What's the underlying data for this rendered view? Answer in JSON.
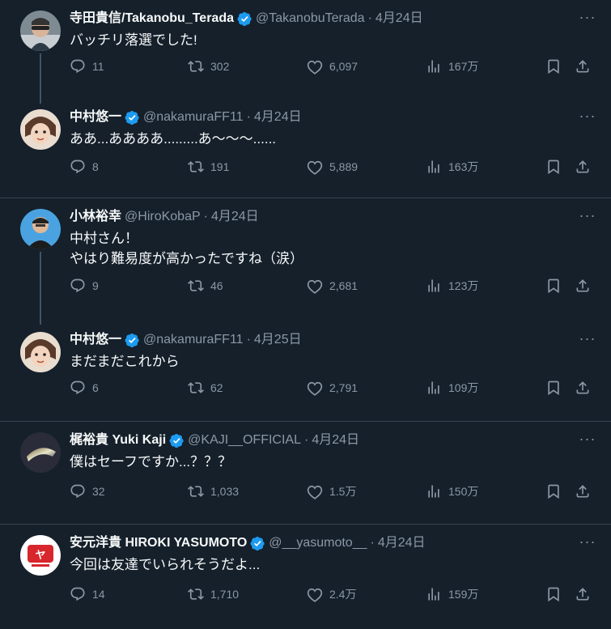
{
  "tweets": [
    {
      "name": "寺田貴信/Takanobu_Terada",
      "handle": "@TakanobuTerada",
      "date": "4月24日",
      "text": "バッチリ落選でした!",
      "replies": "11",
      "retweets": "302",
      "likes": "6,097",
      "views": "167万",
      "verified": true
    },
    {
      "name": "中村悠一",
      "handle": "@nakamuraFF11",
      "date": "4月24日",
      "text": "ああ...ああああ.........あ〜〜〜......",
      "replies": "8",
      "retweets": "191",
      "likes": "5,889",
      "views": "163万",
      "verified": true
    },
    {
      "name": "小林裕幸",
      "handle": "@HiroKobaP",
      "date": "4月24日",
      "text": "中村さん！\nやはり難易度が高かったですね（涙）",
      "replies": "9",
      "retweets": "46",
      "likes": "2,681",
      "views": "123万",
      "verified": false
    },
    {
      "name": "中村悠一",
      "handle": "@nakamuraFF11",
      "date": "4月25日",
      "text": "まだまだこれから",
      "replies": "6",
      "retweets": "62",
      "likes": "2,791",
      "views": "109万",
      "verified": true
    },
    {
      "name": "梶裕貴 Yuki Kaji",
      "handle": "@KAJI__OFFICIAL",
      "date": "4月24日",
      "text": "僕はセーフですか...？？？",
      "replies": "32",
      "retweets": "1,033",
      "likes": "1.5万",
      "views": "150万",
      "verified": true
    },
    {
      "name": "安元洋貴 HIROKI YASUMOTO",
      "handle": "@__yasumoto__",
      "date": "4月24日",
      "text": "今回は友達でいられそうだよ...",
      "replies": "14",
      "retweets": "1,710",
      "likes": "2.4万",
      "views": "159万",
      "verified": true
    }
  ],
  "colors": {
    "background": "#15202b",
    "muted": "#8b98a5",
    "verified": "#1d9bf0",
    "border": "#38444d"
  },
  "icons": [
    "reply-icon",
    "retweet-icon",
    "like-icon",
    "views-icon",
    "bookmark-icon",
    "share-icon",
    "verified-badge-icon",
    "more-icon"
  ]
}
